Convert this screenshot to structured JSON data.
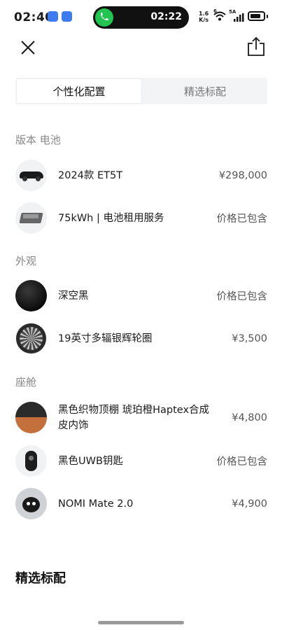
{
  "status_bar": {
    "time": "02:40",
    "call_time": "02:22",
    "net_speed_value": "1.6",
    "net_speed_unit": "K/s",
    "wifi_label": "6",
    "signal_label": "5A",
    "battery_level": 0.85
  },
  "tabs": [
    {
      "label": "个性化配置",
      "active": true
    },
    {
      "label": "精选标配",
      "active": false
    }
  ],
  "sections": {
    "version_battery": {
      "title": "版本 电池",
      "items": [
        {
          "label": "2024款 ET5T",
          "price": "¥298,000"
        },
        {
          "label": "75kWh | 电池租用服务",
          "price": "价格已包含"
        }
      ]
    },
    "exterior": {
      "title": "外观",
      "items": [
        {
          "label": "深空黑",
          "price": "价格已包含"
        },
        {
          "label": "19英寸多辐银辉轮圈",
          "price": "¥3,500"
        }
      ]
    },
    "cabin": {
      "title": "座舱",
      "items": [
        {
          "label": "黑色织物顶棚 琥珀橙Haptex合成皮内饰",
          "price": "¥4,800"
        },
        {
          "label": "黑色UWB钥匙",
          "price": "价格已包含"
        },
        {
          "label": "NOMI Mate 2.0",
          "price": "¥4,900"
        }
      ]
    }
  },
  "featured": {
    "title": "精选标配"
  },
  "colors": {
    "accent_text": "#1a1a1a",
    "muted_text": "#888888",
    "call_green": "#23c552",
    "cabin_orange": "#c4703d"
  },
  "icons": {
    "close": "close-icon",
    "share": "share-icon"
  }
}
